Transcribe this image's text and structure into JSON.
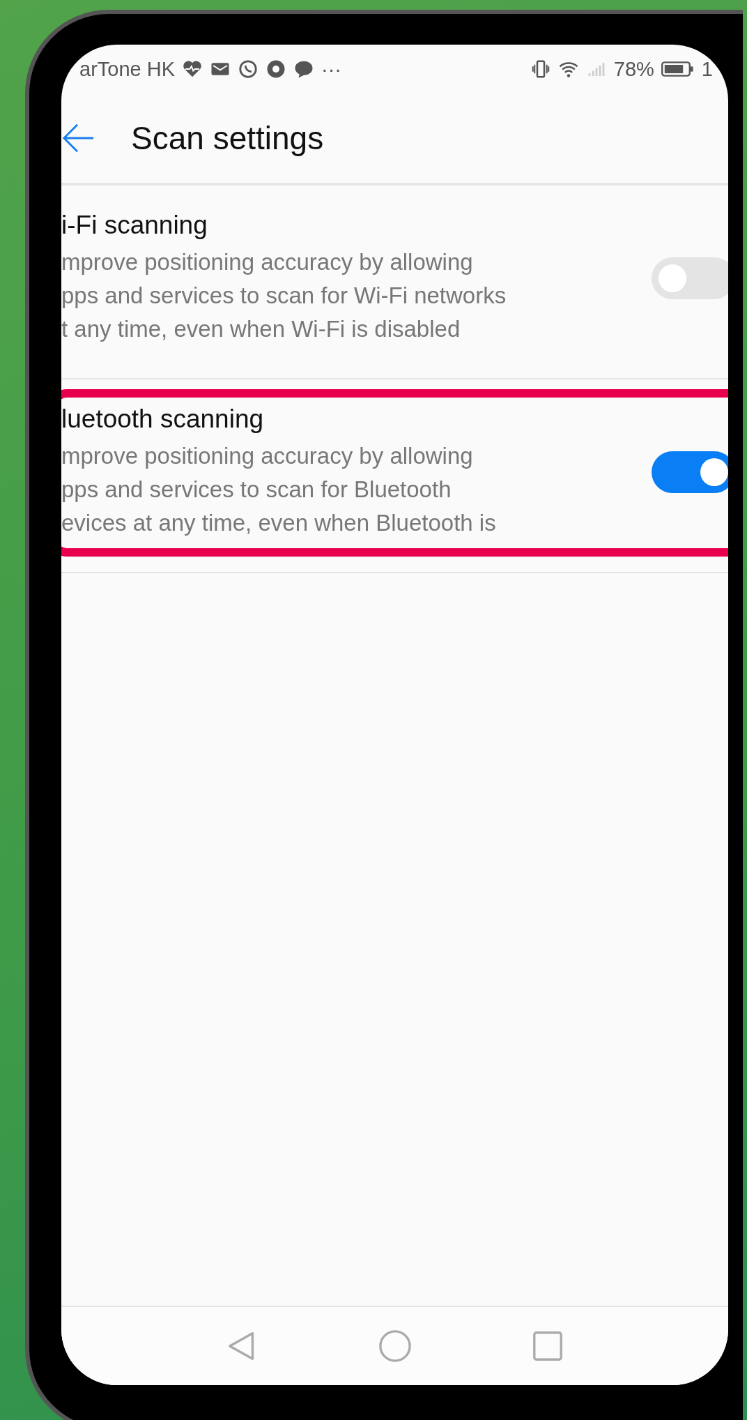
{
  "status_bar": {
    "carrier": "arTone HK",
    "more": "···",
    "battery": "78%",
    "time": "1"
  },
  "header": {
    "title": "Scan settings"
  },
  "settings": [
    {
      "title": "i-Fi scanning",
      "description": "mprove positioning accuracy by allowing\npps and services to scan for Wi-Fi networks\nt any time, even when Wi-Fi is disabled",
      "on": false,
      "highlighted": false
    },
    {
      "title": "luetooth scanning",
      "description": "mprove positioning accuracy by allowing\npps and services to scan for Bluetooth\nevices at any time, even when Bluetooth is",
      "on": true,
      "highlighted": true
    }
  ]
}
